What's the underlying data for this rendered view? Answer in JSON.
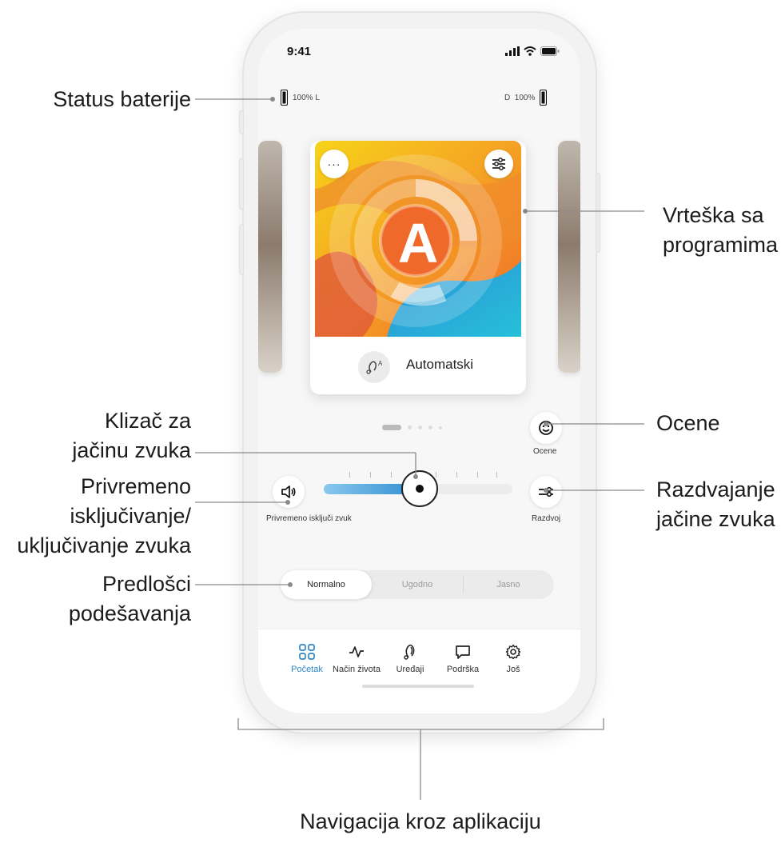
{
  "annotations": {
    "battery_status": "Status baterije",
    "program_carousel": [
      "Vrteška sa",
      "programima"
    ],
    "volume_slider": [
      "Klizač za",
      "jačinu zvuka"
    ],
    "mute_toggle": [
      "Privremeno",
      "isključivanje/",
      "uključivanje zvuka"
    ],
    "presets": [
      "Predlošci",
      "podešavanja"
    ],
    "ratings": "Ocene",
    "volume_split": [
      "Razdvajanje",
      "jačine zvuka"
    ],
    "app_navigation": "Navigacija kroz aplikaciju"
  },
  "status_bar": {
    "time": "9:41"
  },
  "battery": {
    "left_text": "100% L",
    "right_text": "D  100%",
    "left_percent": 100,
    "right_percent": 100
  },
  "program": {
    "letter": "A",
    "name": "Automatski",
    "more_icon": "more-icon",
    "adjust_icon": "sliders-icon"
  },
  "carousel": {
    "pages": 5,
    "active_index": 0
  },
  "ratings_button": {
    "label": "Ocene",
    "icon": "smiley-icon"
  },
  "mute_button": {
    "label": "Privremeno isključi zvuk",
    "icon": "speaker-icon"
  },
  "split_button": {
    "label": "Razdvoj",
    "icon": "split-icon"
  },
  "volume": {
    "level": 0.5
  },
  "presets": {
    "items": [
      "Normalno",
      "Ugodno",
      "Jasno"
    ],
    "selected": "Normalno"
  },
  "tabs": [
    {
      "label": "Početak",
      "icon": "grid-icon",
      "active": true
    },
    {
      "label": "Način života",
      "icon": "pulse-icon",
      "active": false
    },
    {
      "label": "Uređaji",
      "icon": "hearing-aid-icon",
      "active": false
    },
    {
      "label": "Podrška",
      "icon": "chat-icon",
      "active": false
    },
    {
      "label": "Još",
      "icon": "gear-icon",
      "active": false
    }
  ],
  "colors": {
    "accent": "#2f86c6",
    "slider_start": "#8ac8ee",
    "slider_end": "#2f8ed0"
  }
}
